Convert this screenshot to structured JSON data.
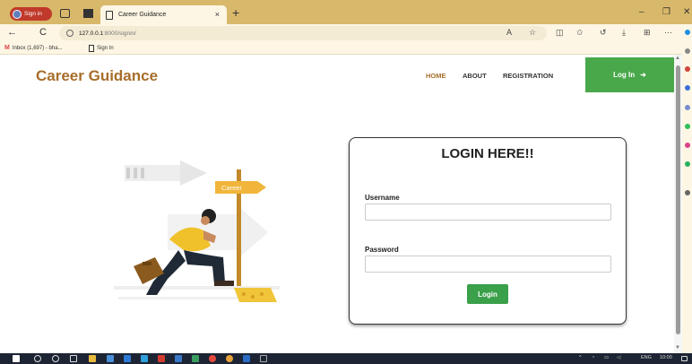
{
  "browser": {
    "profile_label": "Sign in",
    "tab_title": "Career Guidance",
    "tab_close": "×",
    "new_tab": "+",
    "minimize": "–",
    "restore": "❐",
    "close": "✕",
    "back": "←",
    "refresh": "C",
    "url_host": "127.0.0.1",
    "url_path": ":8000/signin/",
    "bookmarks": [
      {
        "label": "Inbox (1,697) - bha..."
      },
      {
        "label": "Sign In"
      }
    ]
  },
  "header": {
    "brand": "Career Guidance",
    "nav": [
      {
        "label": "HOME"
      },
      {
        "label": "ABOUT"
      },
      {
        "label": "REGISTRATION"
      }
    ],
    "login_button": "Log In"
  },
  "illustration": {
    "sign_text": "Career"
  },
  "login_form": {
    "title": "LOGIN HERE!!",
    "username_label": "Username",
    "username_value": "",
    "password_label": "Password",
    "password_value": "",
    "submit_label": "Login"
  },
  "taskbar": {
    "language": "ENG",
    "time": "10:00"
  },
  "colors": {
    "brand": "#a76d2a",
    "tabbar": "#d8b86a",
    "login_green": "#49a84a"
  }
}
